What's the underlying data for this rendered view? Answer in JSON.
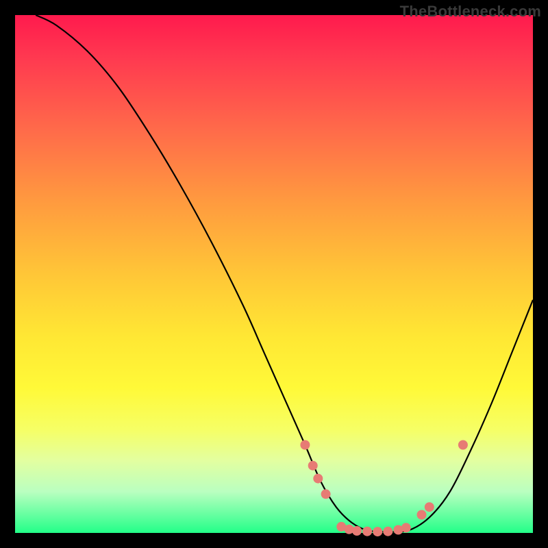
{
  "watermark": "TheBottleneck.com",
  "colors": {
    "dot": "#e77b74",
    "curve": "#000000"
  },
  "chart_data": {
    "type": "line",
    "title": "",
    "xlabel": "",
    "ylabel": "",
    "xlim": [
      0,
      100
    ],
    "ylim": [
      0,
      100
    ],
    "curve": {
      "x": [
        4,
        8,
        14,
        20,
        26,
        32,
        38,
        44,
        48,
        52,
        56,
        59,
        62,
        65,
        68,
        72,
        76,
        80,
        84,
        88,
        92,
        96,
        100
      ],
      "y": [
        100,
        98,
        93,
        86,
        77,
        67,
        56,
        44,
        35,
        26,
        17,
        10,
        5,
        2,
        0.5,
        0.2,
        0.5,
        3,
        8,
        16,
        25,
        35,
        45
      ]
    },
    "series": [
      {
        "name": "markers",
        "points": [
          {
            "x": 56.0,
            "y": 17.0
          },
          {
            "x": 57.5,
            "y": 13.0
          },
          {
            "x": 58.5,
            "y": 10.5
          },
          {
            "x": 60.0,
            "y": 7.5
          },
          {
            "x": 63.0,
            "y": 1.2
          },
          {
            "x": 64.5,
            "y": 0.7
          },
          {
            "x": 66.0,
            "y": 0.4
          },
          {
            "x": 68.0,
            "y": 0.3
          },
          {
            "x": 70.0,
            "y": 0.25
          },
          {
            "x": 72.0,
            "y": 0.3
          },
          {
            "x": 74.0,
            "y": 0.6
          },
          {
            "x": 75.5,
            "y": 1.0
          },
          {
            "x": 78.5,
            "y": 3.5
          },
          {
            "x": 80.0,
            "y": 5.0
          },
          {
            "x": 86.5,
            "y": 17.0
          }
        ]
      }
    ]
  }
}
